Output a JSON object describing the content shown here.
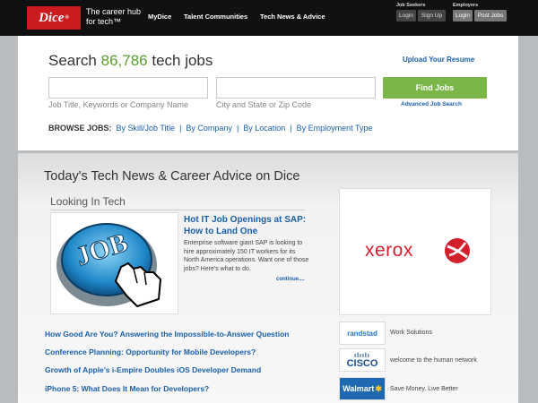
{
  "header": {
    "logo": "Dice",
    "tagline": "The career hub for tech™",
    "nav": [
      "MyDice",
      "Talent Communities",
      "Tech News & Advice"
    ],
    "job_seekers": {
      "label": "Job Seekers",
      "login": "Login",
      "signup": "Sign Up"
    },
    "employers": {
      "label": "Employers",
      "login": "Login",
      "post_jobs": "Post Jobs"
    }
  },
  "search": {
    "title_prefix": "Search",
    "count": "86,786",
    "title_suffix": "tech jobs",
    "upload_resume": "Upload Your Resume",
    "keyword_hint": "Job Title, Keywords or Company Name",
    "location_hint": "City and State or Zip Code",
    "find_button": "Find Jobs",
    "advanced": "Advanced Job Search",
    "browse_label": "BROWSE JOBS:",
    "browse_links": [
      "By Skill/Job Title",
      "By Company",
      "By Location",
      "By Employment Type"
    ]
  },
  "news": {
    "title": "Today's Tech News & Career Advice on Dice",
    "section": "Looking In Tech",
    "image_label": "JOB",
    "featured_title": "Hot IT Job Openings at SAP: How to Land One",
    "featured_body": "Enterprise software giant SAP is looking to hire approximately 150 IT workers for its North America operations. Want one of those jobs? Here's what to do.",
    "continue": "continue....",
    "headlines": [
      "How Good Are You? Answering the Impossible-to-Answer Question",
      "Conference Planning: Opportunity for Mobile Developers?",
      "Growth of Apple's i-Empire Doubles iOS Developer Demand",
      "iPhone 5: What Does It Mean for Developers?"
    ]
  },
  "ads": {
    "main": "xerox",
    "sponsors": [
      {
        "logo": "randstad",
        "tagline": "Work Solutions"
      },
      {
        "logo": "CISCO",
        "tagline": "welcome to the human network"
      },
      {
        "logo": "Walmart",
        "tagline": "Save Money. Live Better"
      }
    ]
  },
  "colors": {
    "brand_red": "#cc1b1f",
    "accent_green": "#7ab648",
    "link_blue": "#1a5fa8"
  }
}
